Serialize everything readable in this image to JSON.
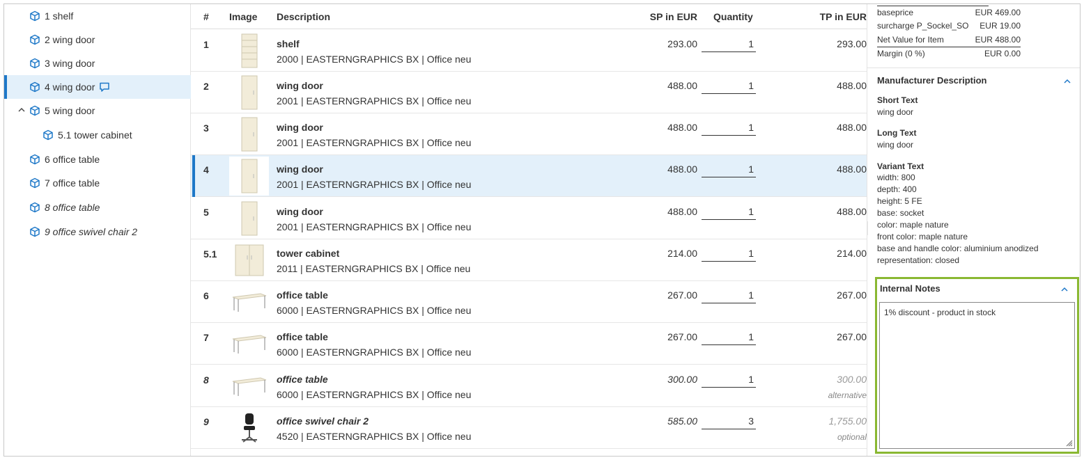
{
  "tree": {
    "items": [
      {
        "label": "1 shelf",
        "italic": false
      },
      {
        "label": "2 wing door",
        "italic": false
      },
      {
        "label": "3 wing door",
        "italic": false
      },
      {
        "label": "4 wing door",
        "italic": false
      },
      {
        "label": "5 wing door",
        "italic": false
      },
      {
        "label": "5.1 tower cabinet",
        "italic": false
      },
      {
        "label": "6 office table",
        "italic": false
      },
      {
        "label": "7 office table",
        "italic": false
      },
      {
        "label": "8 office table",
        "italic": true
      },
      {
        "label": "9 office swivel chair 2",
        "italic": true
      }
    ]
  },
  "table": {
    "headers": {
      "num": "#",
      "image": "Image",
      "description": "Description",
      "sp": "SP in EUR",
      "quantity": "Quantity",
      "tp": "TP in EUR"
    },
    "rows": [
      {
        "num": "1",
        "title": "shelf",
        "sub": "2000 | EASTERNGRAPHICS BX | Office neu",
        "sp": "293.00",
        "qty": "1",
        "tp": "293.00",
        "note": ""
      },
      {
        "num": "2",
        "title": "wing door",
        "sub": "2001 | EASTERNGRAPHICS BX | Office neu",
        "sp": "488.00",
        "qty": "1",
        "tp": "488.00",
        "note": ""
      },
      {
        "num": "3",
        "title": "wing door",
        "sub": "2001 | EASTERNGRAPHICS BX | Office neu",
        "sp": "488.00",
        "qty": "1",
        "tp": "488.00",
        "note": ""
      },
      {
        "num": "4",
        "title": "wing door",
        "sub": "2001 | EASTERNGRAPHICS BX | Office neu",
        "sp": "488.00",
        "qty": "1",
        "tp": "488.00",
        "note": ""
      },
      {
        "num": "5",
        "title": "wing door",
        "sub": "2001 | EASTERNGRAPHICS BX | Office neu",
        "sp": "488.00",
        "qty": "1",
        "tp": "488.00",
        "note": ""
      },
      {
        "num": "5.1",
        "title": "tower cabinet",
        "sub": "2011 | EASTERNGRAPHICS BX | Office neu",
        "sp": "214.00",
        "qty": "1",
        "tp": "214.00",
        "note": ""
      },
      {
        "num": "6",
        "title": "office table",
        "sub": "6000 | EASTERNGRAPHICS BX | Office neu",
        "sp": "267.00",
        "qty": "1",
        "tp": "267.00",
        "note": ""
      },
      {
        "num": "7",
        "title": "office table",
        "sub": "6000 | EASTERNGRAPHICS BX | Office neu",
        "sp": "267.00",
        "qty": "1",
        "tp": "267.00",
        "note": ""
      },
      {
        "num": "8",
        "title": "office table",
        "sub": "6000 | EASTERNGRAPHICS BX | Office neu",
        "sp": "300.00",
        "qty": "1",
        "tp": "300.00",
        "note": "alternative"
      },
      {
        "num": "9",
        "title": "office swivel chair 2",
        "sub": "4520 | EASTERNGRAPHICS BX | Office neu",
        "sp": "585.00",
        "qty": "3",
        "tp": "1,755.00",
        "note": "optional"
      }
    ]
  },
  "panel": {
    "prices": [
      {
        "label": "baseprice",
        "value": "EUR 469.00"
      },
      {
        "label": "surcharge P_Sockel_SO",
        "value": "EUR 19.00"
      },
      {
        "label": "Net Value for Item",
        "value": "EUR 488.00"
      },
      {
        "label": "Margin (0 %)",
        "value": "EUR 0.00"
      }
    ],
    "manufacturer": {
      "title": "Manufacturer Description",
      "short_label": "Short Text",
      "short_value": "wing door",
      "long_label": "Long Text",
      "long_value": "wing door",
      "variant_label": "Variant Text",
      "variant_lines": [
        "width: 800",
        "depth: 400",
        "height: 5 FE",
        "base: socket",
        "color: maple nature",
        "front color: maple nature",
        "base and handle color: aluminium anodized",
        "representation: closed"
      ]
    },
    "notes": {
      "title": "Internal Notes",
      "value": "1% discount - product in stock"
    }
  },
  "colors": {
    "selection": "#e3f0fa",
    "accent": "#1e78c8",
    "highlight_border": "#8ab832"
  }
}
